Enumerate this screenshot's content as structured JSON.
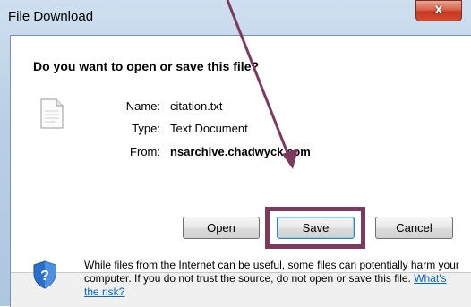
{
  "window": {
    "title": "File Download",
    "close_label": "x"
  },
  "dialog": {
    "question": "Do you want to open or save this file?",
    "name_label": "Name:",
    "name_value": "citation.txt",
    "type_label": "Type:",
    "type_value": "Text Document",
    "from_label": "From:",
    "from_value": "nsarchive.chadwyck.com"
  },
  "buttons": {
    "open": "Open",
    "save": "Save",
    "cancel": "Cancel"
  },
  "warning": {
    "text": "While files from the Internet can be useful, some files can potentially harm your computer. If you do not trust the source, do not open or save this file. ",
    "link": "What's the risk?"
  },
  "colors": {
    "highlight": "#7c3a5c",
    "link": "#0066cc"
  },
  "icons": [
    "file-icon",
    "security-shield-icon",
    "close-icon",
    "annotation-arrow"
  ]
}
